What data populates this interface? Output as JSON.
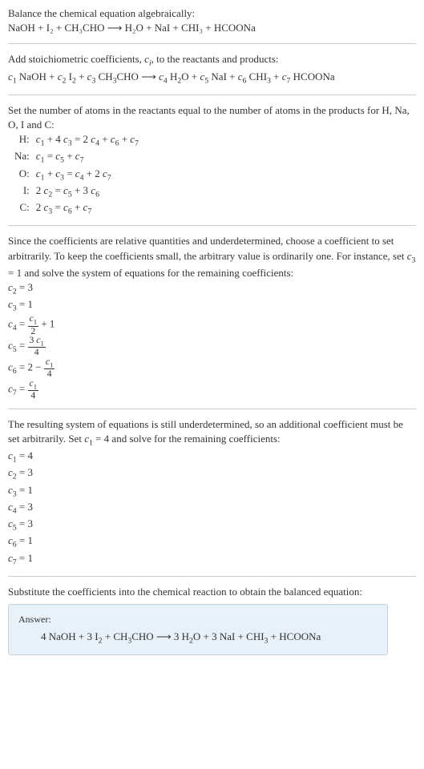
{
  "intro": {
    "line1": "Balance the chemical equation algebraically:",
    "reaction": "NaOH + I₂ + CH₃CHO ⟶ H₂O + NaI + CHI₃ + HCOONa"
  },
  "step2": {
    "text": "Add stoichiometric coefficients, cᵢ, to the reactants and products:",
    "reaction": "c₁ NaOH + c₂ I₂ + c₃ CH₃CHO ⟶ c₄ H₂O + c₅ NaI + c₆ CHI₃ + c₇ HCOONa"
  },
  "step3": {
    "text": "Set the number of atoms in the reactants equal to the number of atoms in the products for H, Na, O, I and C:",
    "rows": [
      {
        "label": "H:",
        "eq": "c₁ + 4 c₃ = 2 c₄ + c₆ + c₇"
      },
      {
        "label": "Na:",
        "eq": "c₁ = c₅ + c₇"
      },
      {
        "label": "O:",
        "eq": "c₁ + c₃ = c₄ + 2 c₇"
      },
      {
        "label": "I:",
        "eq": "2 c₂ = c₅ + 3 c₆"
      },
      {
        "label": "C:",
        "eq": "2 c₃ = c₆ + c₇"
      }
    ]
  },
  "step4": {
    "text": "Since the coefficients are relative quantities and underdetermined, choose a coefficient to set arbitrarily. To keep the coefficients small, the arbitrary value is ordinarily one. For instance, set c₃ = 1 and solve the system of equations for the remaining coefficients:",
    "c2": "c₂ = 3",
    "c3": "c₃ = 1",
    "c4_pre": "c₄ = ",
    "c4_num": "c₁",
    "c4_den": "2",
    "c4_post": " + 1",
    "c5_pre": "c₅ = ",
    "c5_num": "3 c₁",
    "c5_den": "4",
    "c6_pre": "c₆ = 2 − ",
    "c6_num": "c₁",
    "c6_den": "4",
    "c7_pre": "c₇ = ",
    "c7_num": "c₁",
    "c7_den": "4"
  },
  "step5": {
    "text": "The resulting system of equations is still underdetermined, so an additional coefficient must be set arbitrarily. Set c₁ = 4 and solve for the remaining coefficients:",
    "lines": [
      "c₁ = 4",
      "c₂ = 3",
      "c₃ = 1",
      "c₄ = 3",
      "c₅ = 3",
      "c₆ = 1",
      "c₇ = 1"
    ]
  },
  "final": {
    "text": "Substitute the coefficients into the chemical reaction to obtain the balanced equation:",
    "answer_label": "Answer:",
    "answer_eq": "4 NaOH + 3 I₂ + CH₃CHO ⟶ 3 H₂O + 3 NaI + CHI₃ + HCOONa"
  }
}
